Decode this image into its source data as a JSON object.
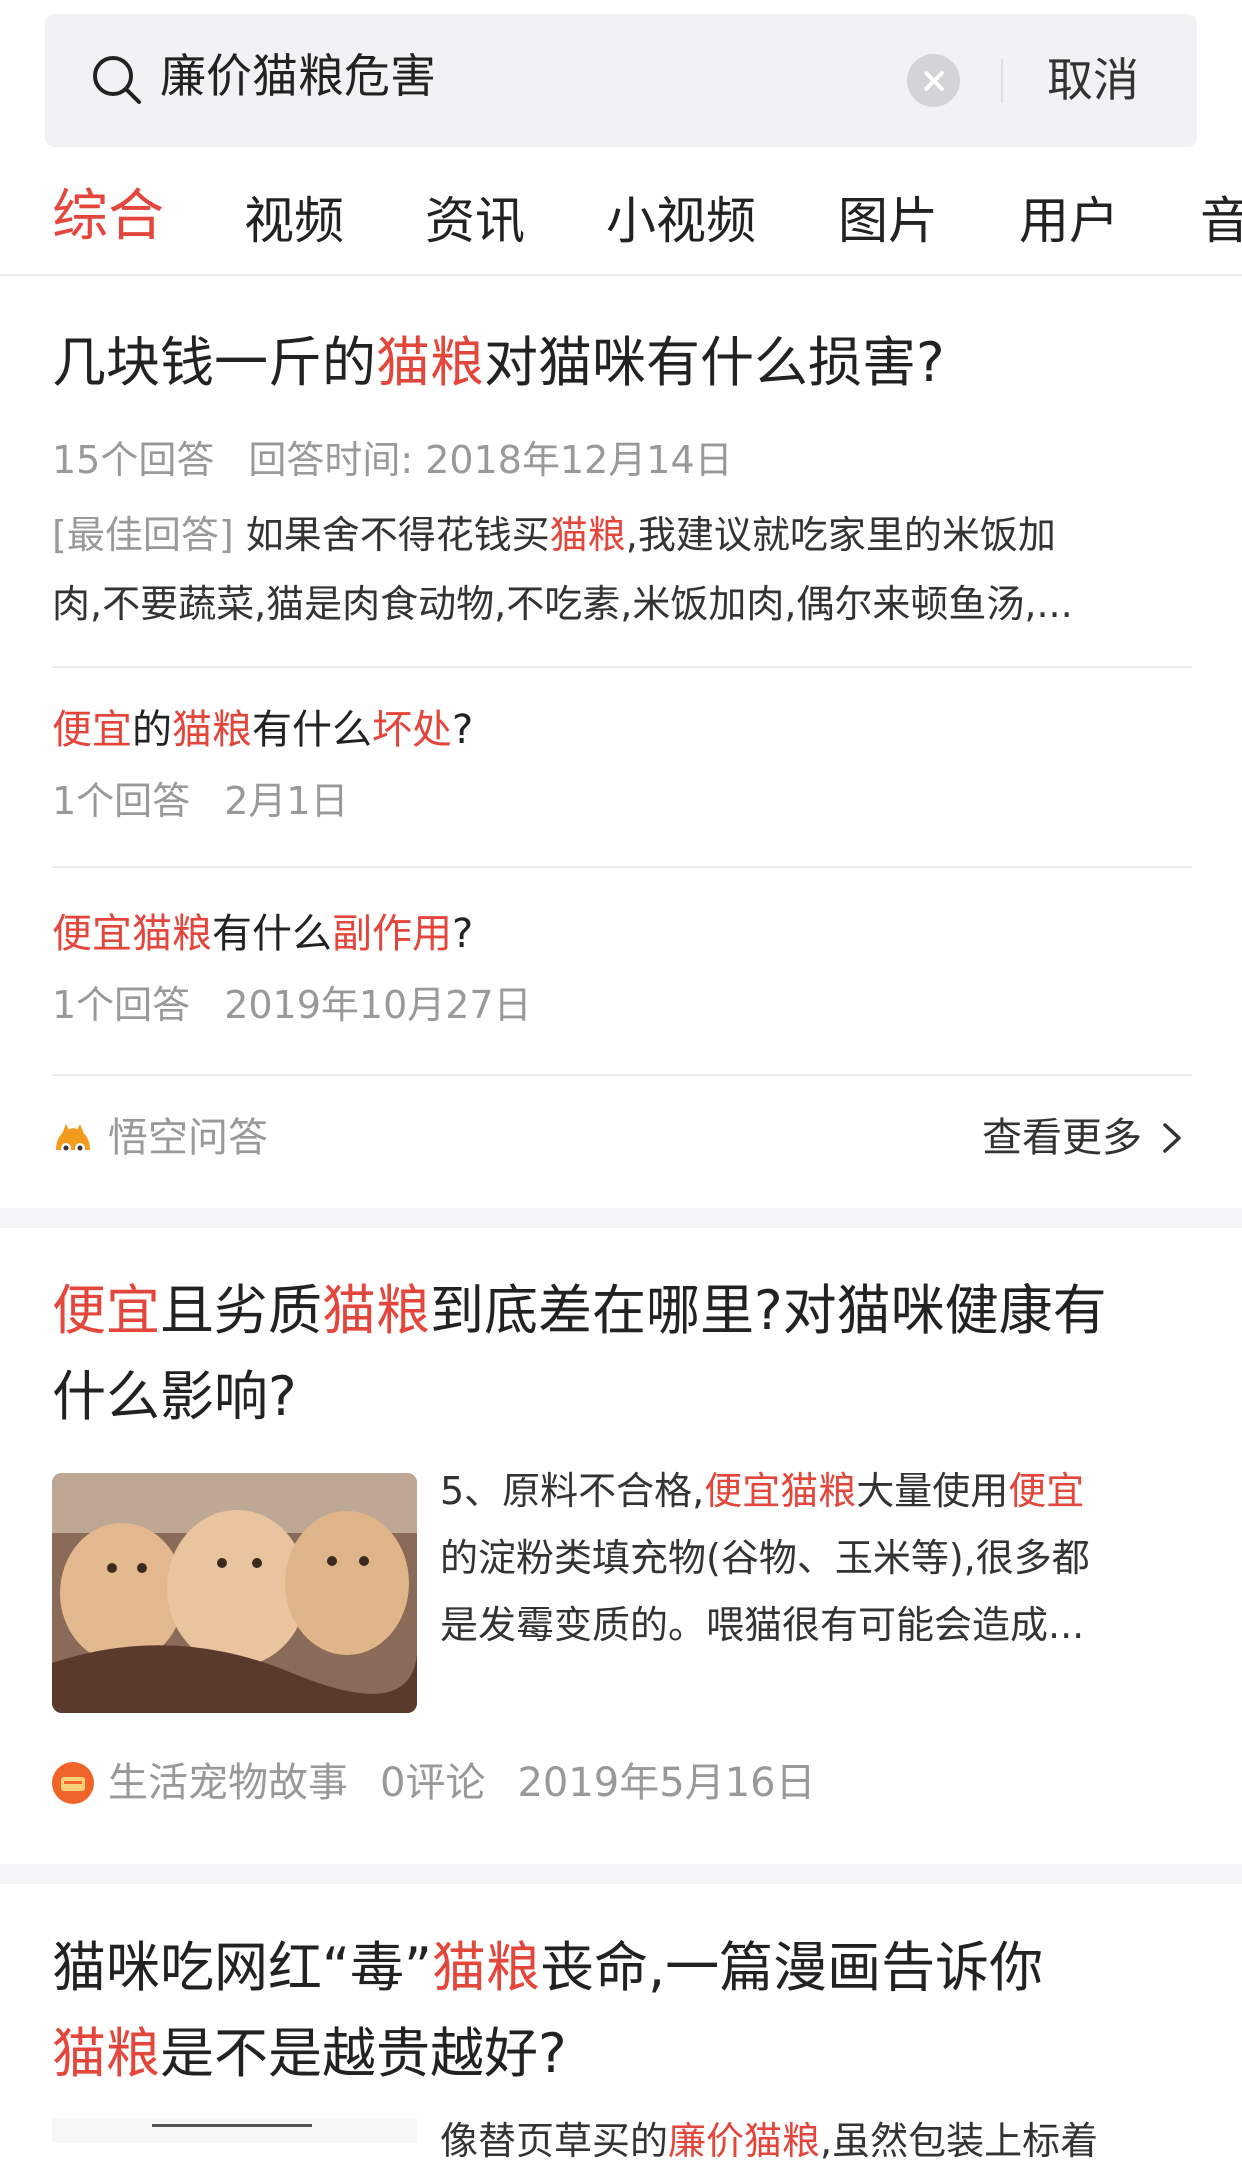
{
  "search": {
    "value": "廉价猫粮危害",
    "cancel_label": "取消"
  },
  "tabs": [
    "综合",
    "视频",
    "资讯",
    "小视频",
    "图片",
    "用户",
    "音"
  ],
  "qa_card": {
    "title_parts": [
      "几块钱一斤的",
      "猫粮",
      "对猫咪有什么损害?"
    ],
    "answers": "15个回答",
    "answer_time": "回答时间: 2018年12月14日",
    "best_tag": "[最佳回答]",
    "best_parts": [
      " 如果舍不得花钱买",
      "猫粮",
      ",我建议就吃家里的米饭加"
    ],
    "best_line2": "肉,不要蔬菜,猫是肉食动物,不吃素,米饭加肉,偶尔来顿鱼汤,...",
    "related": [
      {
        "parts": [
          "便宜",
          "的",
          "猫粮",
          "有什么",
          "坏处",
          "?"
        ],
        "count": "1个回答",
        "date": "2月1日"
      },
      {
        "parts": [
          "便宜猫粮",
          "有什么",
          "副作用",
          "?"
        ],
        "count": "1个回答",
        "date": "2019年10月27日"
      }
    ],
    "source": "悟空问答",
    "more_label": "查看更多"
  },
  "article1": {
    "title_parts": [
      "便宜",
      "且劣质",
      "猫粮",
      "到底差在哪里?对猫咪健康有"
    ],
    "title_line2": "什么影响?",
    "snippet_parts": [
      "5、原料不合格,",
      "便宜猫粮",
      "大量使用",
      "便宜"
    ],
    "snippet_line2": "的淀粉类填充物(谷物、玉米等),很多都",
    "snippet_line3": "是发霉变质的。喂猫很有可能会造成...",
    "source": "生活宠物故事",
    "comments": "0评论",
    "date": "2019年5月16日"
  },
  "article2": {
    "title_parts": [
      "猫咪吃网红“毒”",
      "猫粮",
      "丧命,一篇漫画告诉你"
    ],
    "title_line2_parts": [
      "猫粮",
      "是不是越贵越好?"
    ],
    "snippet_parts": [
      "像替页草买的",
      "廉价猫粮",
      ",虽然包装上标着"
    ]
  },
  "colors": {
    "accent": "#e5463c",
    "meta": "#999999",
    "background": "#ffffff"
  }
}
